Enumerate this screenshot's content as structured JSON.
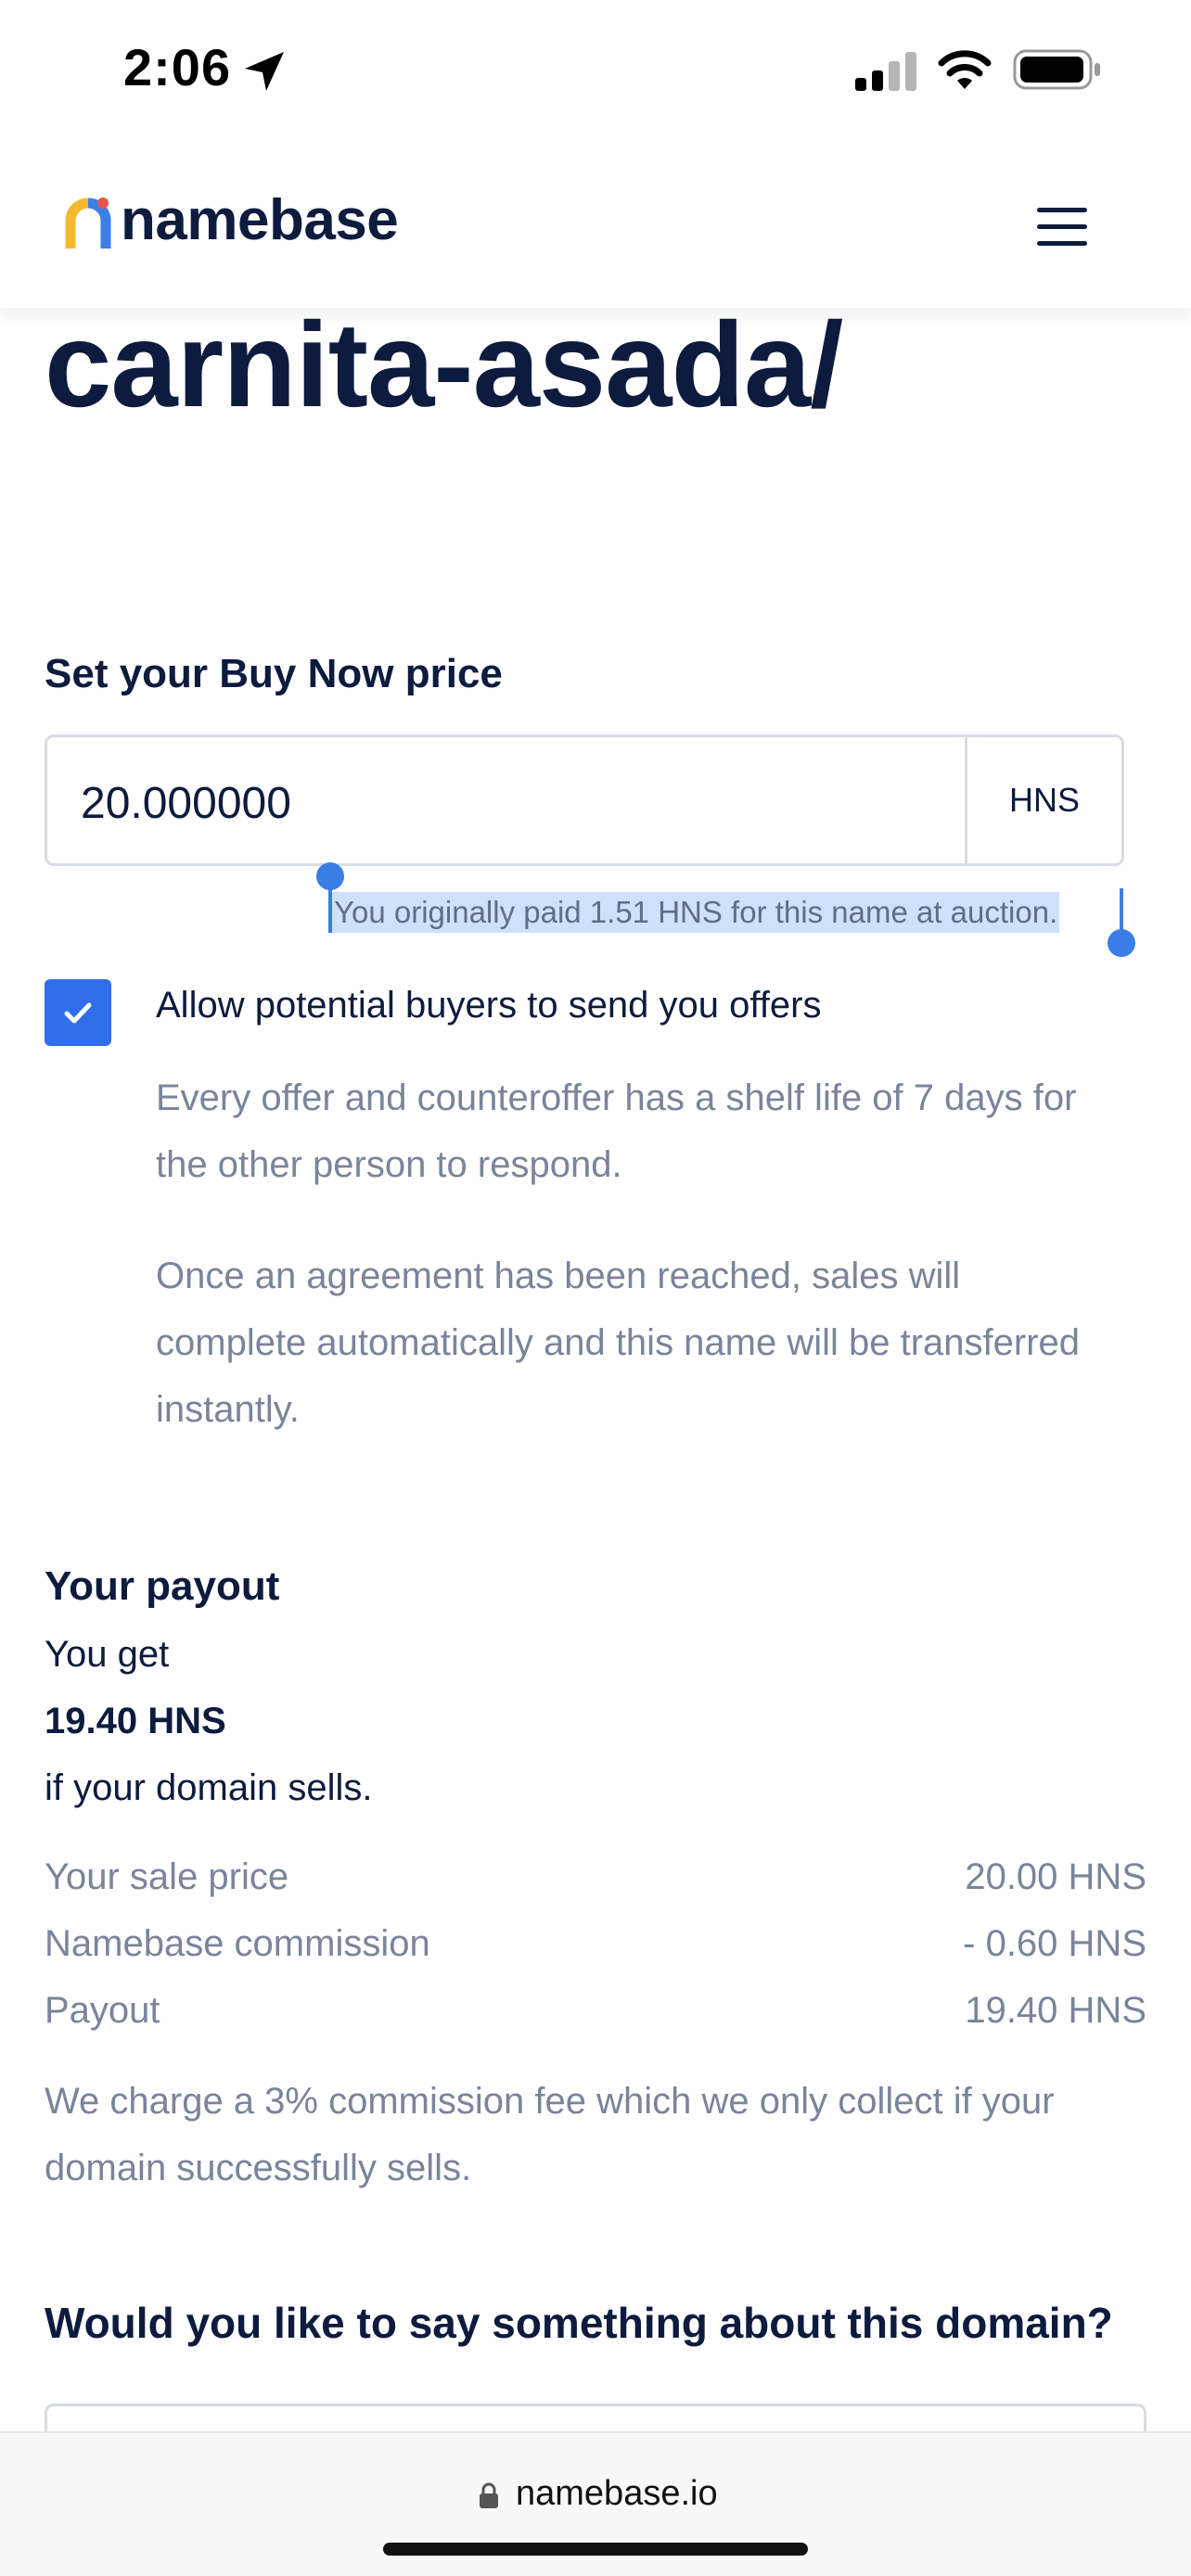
{
  "status_bar": {
    "time": "2:06",
    "icons": [
      "location-arrow-icon",
      "cellular-signal-icon",
      "wifi-icon",
      "battery-icon"
    ]
  },
  "header": {
    "logo_text": "namebase",
    "logo_icon": "namebase-logo-icon",
    "menu_icon": "hamburger-menu-icon"
  },
  "domain": {
    "name": "carnita-asada/"
  },
  "buy_now": {
    "heading": "Set your Buy Now price",
    "price_value": "20.000000",
    "currency": "HNS",
    "paid_note": "You originally paid 1.51 HNS for this name at auction."
  },
  "offers": {
    "checked": true,
    "label": "Allow potential buyers to send you offers",
    "note_1": "Every offer and counteroffer has a shelf life of 7 days for the other person to respond.",
    "note_2": "Once an agreement has been reached, sales will complete automatically and this name will be transferred instantly."
  },
  "payout": {
    "heading": "Your payout",
    "you_get": "You get",
    "amount": "19.40 HNS",
    "condition": "if your domain sells.",
    "breakdown": [
      {
        "label": "Your sale price",
        "value": "20.00 HNS"
      },
      {
        "label": "Namebase commission",
        "value": "- 0.60 HNS"
      },
      {
        "label": "Payout",
        "value": "19.40 HNS"
      }
    ],
    "commission_note": "We charge a 3% commission fee which we only collect if your domain successfully sells."
  },
  "message": {
    "heading": "Would you like to say something about this domain?"
  },
  "browser": {
    "url": "namebase.io"
  },
  "colors": {
    "primary_text": "#0d1b3e",
    "muted_text": "#7a849a",
    "accent_blue": "#2f6ee8",
    "selection": "#cfe0fb",
    "border": "#d8dce3"
  }
}
